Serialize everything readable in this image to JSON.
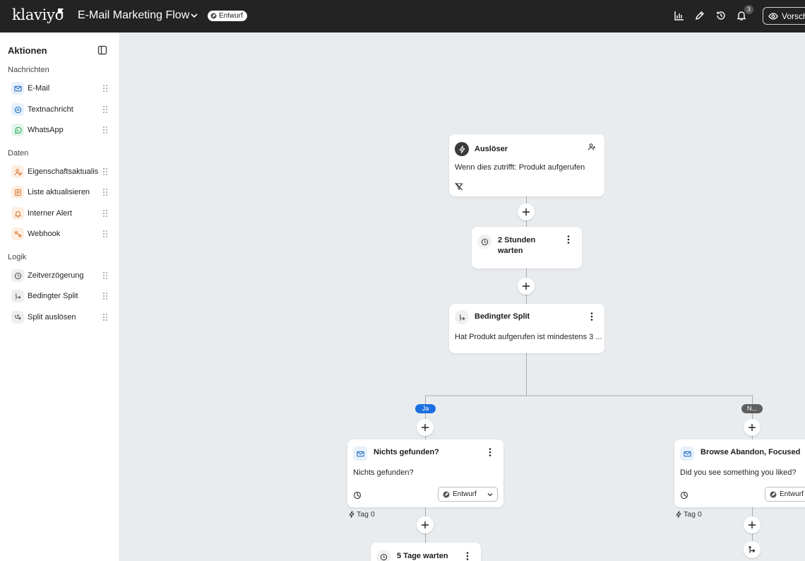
{
  "app": {
    "logo_text": "klaviyo",
    "flow_title": "E-Mail Marketing Flow",
    "status_badge": "Entwurf",
    "notification_count": "3",
    "preview_label": "Vorschau"
  },
  "sidebar": {
    "heading": "Aktionen",
    "sections": [
      {
        "title": "Nachrichten",
        "items": [
          {
            "label": "E-Mail",
            "icon": "mail-icon"
          },
          {
            "label": "Textnachricht",
            "icon": "sms-icon"
          },
          {
            "label": "WhatsApp",
            "icon": "whatsapp-icon"
          }
        ]
      },
      {
        "title": "Daten",
        "items": [
          {
            "label": "Eigenschaftsaktualisieren",
            "icon": "user-edit-icon"
          },
          {
            "label": "Liste aktualisieren",
            "icon": "list-icon"
          },
          {
            "label": "Interner Alert",
            "icon": "bell-icon"
          },
          {
            "label": "Webhook",
            "icon": "webhook-icon"
          }
        ]
      },
      {
        "title": "Logik",
        "items": [
          {
            "label": "Zeitverzögerung",
            "icon": "clock-icon"
          },
          {
            "label": "Bedingter Split",
            "icon": "split-icon"
          },
          {
            "label": "Split auslösen",
            "icon": "trigger-split-icon"
          }
        ]
      }
    ]
  },
  "canvas": {
    "trigger": {
      "title": "Auslöser",
      "body": "Wenn dies zutrifft: Produkt aufgerufen"
    },
    "delay1": {
      "title_line1": "2 Stunden",
      "title_line2": "warten"
    },
    "split": {
      "title": "Bedingter Split",
      "body": "Hat Produkt aufgerufen ist mindestens 3 ..."
    },
    "branch_yes": "Ja",
    "branch_no": "N...",
    "email_left": {
      "title": "Nichts gefunden?",
      "body": "Nichts gefunden?",
      "status": "Entwurf",
      "tag": "Tag 0"
    },
    "email_right": {
      "title": "Browse Abandon, Focused",
      "body": "Did you see something you liked?",
      "status": "Entwurf",
      "tag": "Tag 0"
    },
    "delay2": {
      "title": "5 Tage warten"
    }
  },
  "colors": {
    "topbar_bg": "#232323",
    "canvas_bg": "#e9ecef",
    "branch_yes": "#1b6fe0",
    "branch_no": "#5f5f5f"
  }
}
